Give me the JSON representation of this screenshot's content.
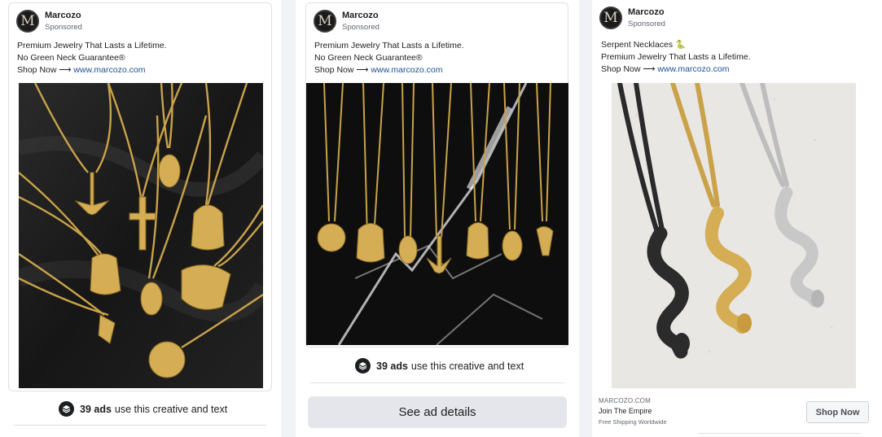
{
  "ads": [
    {
      "brand": "Marcozo",
      "avatar_letter": "M",
      "sponsored": "Sponsored",
      "line1": "Premium Jewelry That Lasts a Lifetime.",
      "line2": "No Green Neck Guarantee®",
      "shop_prefix": "Shop Now ⟶",
      "url": "www.marcozo.com",
      "ads_count": "39 ads",
      "ads_suffix": "use this creative and text"
    },
    {
      "brand": "Marcozo",
      "avatar_letter": "M",
      "sponsored": "Sponsored",
      "line1": "Premium Jewelry That Lasts a Lifetime.",
      "line2": "No Green Neck Guarantee®",
      "shop_prefix": "Shop Now ⟶",
      "url": "www.marcozo.com",
      "ads_count": "39 ads",
      "ads_suffix": "use this creative and text",
      "see_details": "See ad details"
    },
    {
      "brand": "Marcozo",
      "avatar_letter": "M",
      "sponsored": "Sponsored",
      "line1": "Serpent Necklaces 🐍",
      "line2": "Premium Jewelry That Lasts a Lifetime.",
      "shop_prefix": "Shop Now ⟶",
      "url": "www.marcozo.com",
      "footer_domain": "MARCOZO.COM",
      "footer_title": "Join The Empire",
      "footer_desc": "Free Shipping Worldwide",
      "cta": "Shop Now"
    }
  ],
  "colors": {
    "link": "#1d4f91",
    "gold": "#c9a24a",
    "silver": "#c8c8c8",
    "black_steel": "#2a2a2a"
  }
}
